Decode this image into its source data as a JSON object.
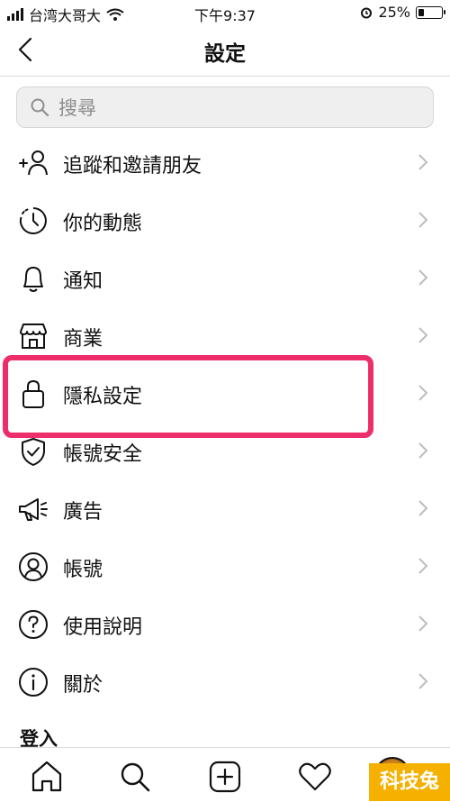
{
  "status_bar": {
    "carrier": "台湾大哥大",
    "time": "下午9:37",
    "battery": "25%",
    "battery_level": 0.25
  },
  "nav": {
    "title": "設定"
  },
  "search": {
    "placeholder": "搜尋"
  },
  "menu": [
    {
      "label": "追蹤和邀請朋友",
      "icon": "add-person-icon"
    },
    {
      "label": "你的動態",
      "icon": "activity-clock-icon"
    },
    {
      "label": "通知",
      "icon": "bell-icon"
    },
    {
      "label": "商業",
      "icon": "shop-icon"
    },
    {
      "label": "隱私設定",
      "icon": "lock-icon"
    },
    {
      "label": "帳號安全",
      "icon": "shield-check-icon"
    },
    {
      "label": "廣告",
      "icon": "megaphone-icon"
    },
    {
      "label": "帳號",
      "icon": "account-circle-icon"
    },
    {
      "label": "使用說明",
      "icon": "help-icon"
    },
    {
      "label": "關於",
      "icon": "info-icon"
    }
  ],
  "login": {
    "label": "登入"
  },
  "tab_bar": [
    "home-icon",
    "search-icon",
    "new-post-icon",
    "heart-icon",
    "profile-avatar"
  ],
  "watermark": "科技兔",
  "colors": {
    "highlight": "#ee2d6b",
    "watermark_bg": "#f5b000"
  }
}
